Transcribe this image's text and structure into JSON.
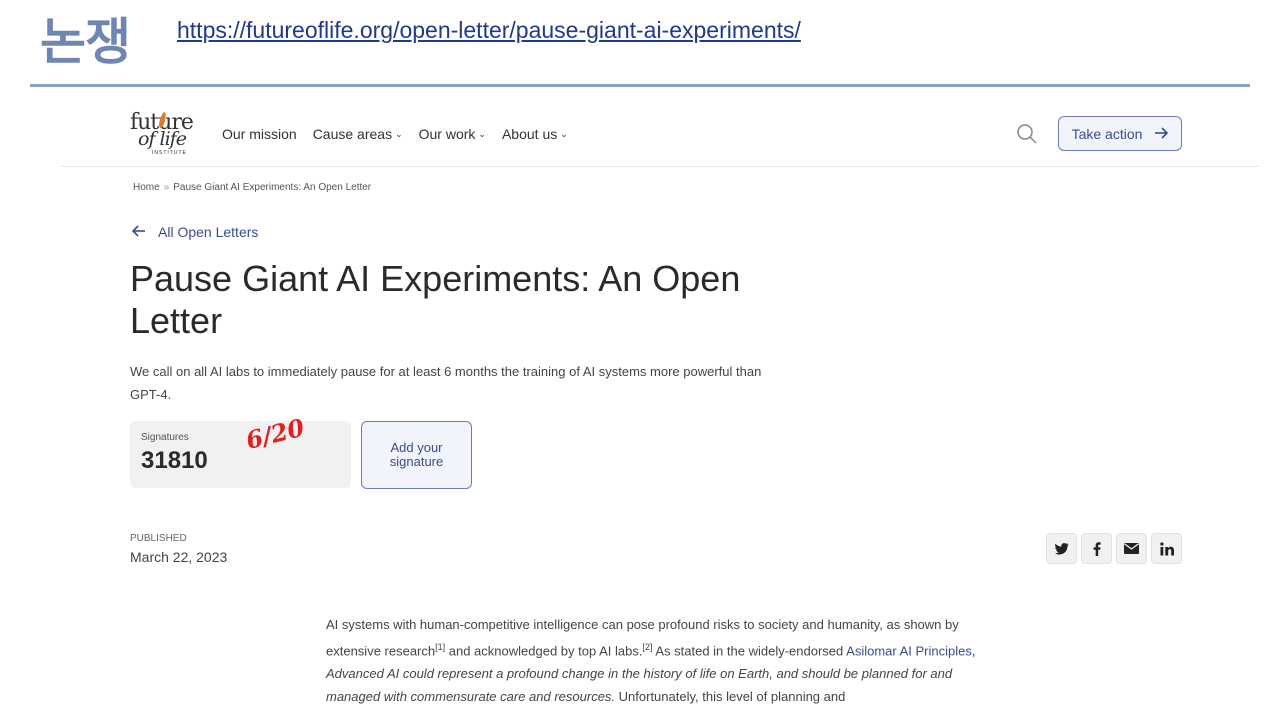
{
  "slide": {
    "title": "논쟁",
    "url": "https://futureoflife.org/open-letter/pause-giant-ai-experiments/"
  },
  "nav": {
    "logo": {
      "line1": "future",
      "line2": "of life",
      "line3": "INSTITUTE"
    },
    "items": [
      {
        "label": "Our mission",
        "has_dropdown": false
      },
      {
        "label": "Cause areas",
        "has_dropdown": true
      },
      {
        "label": "Our work",
        "has_dropdown": true
      },
      {
        "label": "About us",
        "has_dropdown": true
      }
    ],
    "search_icon": "search-icon",
    "take_action": "Take action"
  },
  "breadcrumb": {
    "home": "Home",
    "separator": "»",
    "current": "Pause Giant AI Experiments: An Open Letter"
  },
  "back_link": "All Open Letters",
  "title": "Pause Giant AI Experiments: An Open Letter",
  "lead": "We call on all AI labs to immediately pause for at least 6 months the training of AI systems more powerful than GPT-4.",
  "signatures": {
    "label": "Signatures",
    "count": "31810",
    "annotation": "6/20"
  },
  "add_signature": "Add your signature",
  "published": {
    "label": "PUBLISHED",
    "date": "March 22, 2023"
  },
  "share_icons": [
    "twitter-icon",
    "facebook-icon",
    "email-icon",
    "linkedin-icon"
  ],
  "body": {
    "p1_a": "AI systems with human-competitive intelligence can pose profound risks to society and humanity, as shown by extensive research",
    "ref1": "[1]",
    "p1_b": " and acknowledged by top AI labs.",
    "ref2": "[2]",
    "p1_c": " As stated in the widely-endorsed ",
    "link": "Asilomar AI Principles",
    "p1_d": ", ",
    "quote": "Advanced AI could represent a profound change in the history of life on Earth, and should be planned for and managed with commensurate care and resources.",
    "p1_e": " Unfortunately, this level of planning and"
  },
  "colors": {
    "accent": "#3a4c8a",
    "slide_title": "#6f86b5",
    "annotation": "#e02020"
  }
}
